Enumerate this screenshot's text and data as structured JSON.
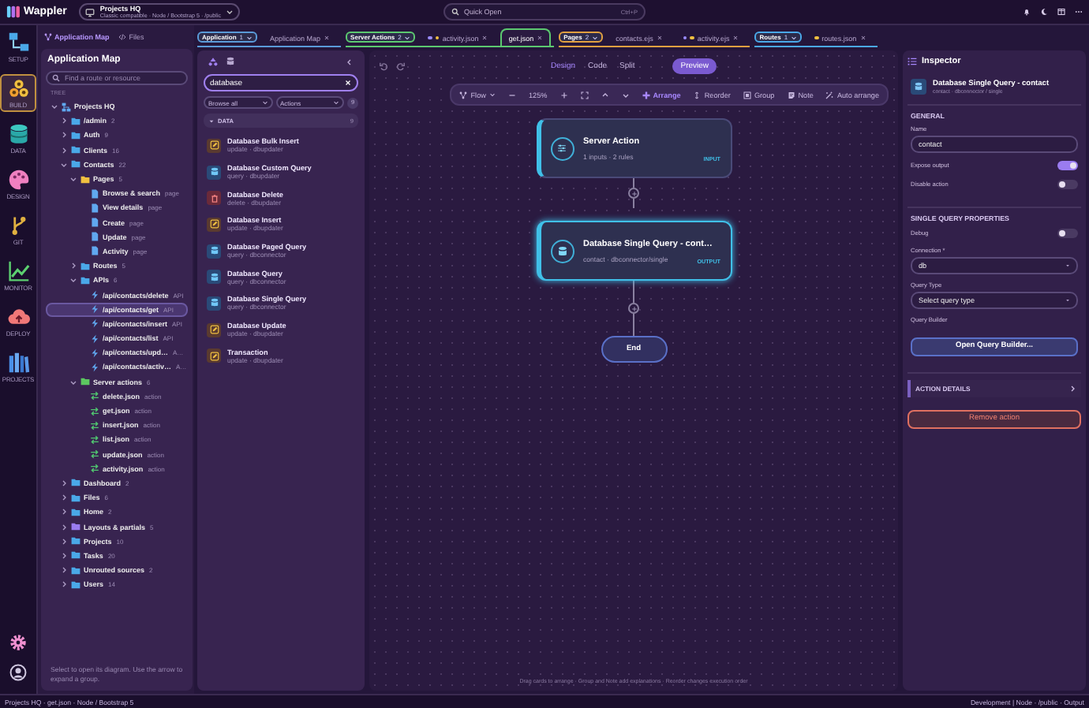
{
  "titlebar": {
    "app_name": "Wappler",
    "project": "Projects HQ",
    "project_detail": "Classic compatible · Node / Bootstrap 5 · /public",
    "search_placeholder": "Quick Open",
    "search_shortcut": "Ctrl+P"
  },
  "rail": [
    {
      "kind": "setup",
      "label": "SETUP",
      "selected": false
    },
    {
      "kind": "build",
      "label": "BUILD",
      "selected": true
    },
    {
      "kind": "data",
      "label": "DATA",
      "selected": false
    },
    {
      "kind": "design",
      "label": "DESIGN",
      "selected": false
    },
    {
      "kind": "git",
      "label": "GIT",
      "selected": false
    },
    {
      "kind": "monitor",
      "label": "MONITOR",
      "selected": false
    },
    {
      "kind": "deploy",
      "label": "DEPLOY",
      "selected": false
    },
    {
      "kind": "projects",
      "label": "PROJECTS",
      "selected": false
    }
  ],
  "left_tabs": [
    {
      "kind": "map",
      "label": "Application Map",
      "selected": true
    },
    {
      "kind": "files",
      "label": "Files",
      "selected": false
    }
  ],
  "app_map": {
    "title": "Application Map",
    "search_placeholder": "Find a route or resource",
    "tree_label": "TREE",
    "hint": "Select to open its diagram. Use the arrow to expand a group.",
    "tree": [
      {
        "kind": "project",
        "label": "Projects HQ",
        "expanded": true,
        "selected": false,
        "children": [
          {
            "kind": "folder",
            "color": "#4aa8e8",
            "label": "/admin",
            "count": "2",
            "expanded": false,
            "selected": false
          },
          {
            "kind": "folder",
            "color": "#4aa8e8",
            "label": "Auth",
            "count": "9",
            "expanded": false,
            "selected": false
          },
          {
            "kind": "folder",
            "color": "#4aa8e8",
            "label": "Clients",
            "count": "16",
            "expanded": false,
            "selected": false
          },
          {
            "kind": "folder",
            "color": "#4aa8e8",
            "label": "Contacts",
            "count": "22",
            "expanded": true,
            "selected": false,
            "children": [
              {
                "kind": "folder",
                "color": "#f0c040",
                "label": "Pages",
                "count": "5",
                "expanded": true,
                "selected": false,
                "children": [
                  {
                    "kind": "page",
                    "label": "Browse & search",
                    "count": "page",
                    "selected": false
                  },
                  {
                    "kind": "page",
                    "label": "View details",
                    "count": "page",
                    "selected": false
                  },
                  {
                    "kind": "page",
                    "label": "Create",
                    "count": "page",
                    "selected": false
                  },
                  {
                    "kind": "page",
                    "label": "Update",
                    "count": "page",
                    "selected": false
                  },
                  {
                    "kind": "page",
                    "label": "Activity",
                    "count": "page",
                    "selected": false
                  }
                ]
              },
              {
                "kind": "folder",
                "color": "#4aa8e8",
                "label": "Routes",
                "count": "5",
                "expanded": false,
                "selected": false
              },
              {
                "kind": "folder",
                "color": "#4aa8e8",
                "label": "APIs",
                "count": "6",
                "expanded": true,
                "selected": false,
                "children": [
                  {
                    "kind": "api",
                    "label": "/api/contacts/delete",
                    "count": "API",
                    "selected": false
                  },
                  {
                    "kind": "api",
                    "label": "/api/contacts/get",
                    "count": "API",
                    "selected": true
                  },
                  {
                    "kind": "api",
                    "label": "/api/contacts/insert",
                    "count": "API",
                    "selected": false
                  },
                  {
                    "kind": "api",
                    "label": "/api/contacts/list",
                    "count": "API",
                    "selected": false
                  },
                  {
                    "kind": "api",
                    "label": "/api/contacts/upd…",
                    "count": "A…",
                    "selected": false
                  },
                  {
                    "kind": "api",
                    "label": "/api/contacts/activ…",
                    "count": "A…",
                    "selected": false
                  }
                ]
              },
              {
                "kind": "folder",
                "color": "#5cc860",
                "label": "Server actions",
                "count": "6",
                "expanded": true,
                "selected": false,
                "children": [
                  {
                    "kind": "action",
                    "label": "delete.json",
                    "count": "action",
                    "selected": false
                  },
                  {
                    "kind": "action",
                    "label": "get.json",
                    "count": "action",
                    "selected": false
                  },
                  {
                    "kind": "action",
                    "label": "insert.json",
                    "count": "action",
                    "selected": false
                  },
                  {
                    "kind": "action",
                    "label": "list.json",
                    "count": "action",
                    "selected": false
                  },
                  {
                    "kind": "action",
                    "label": "update.json",
                    "count": "action",
                    "selected": false
                  },
                  {
                    "kind": "action",
                    "label": "activity.json",
                    "count": "action",
                    "selected": false
                  }
                ]
              }
            ]
          },
          {
            "kind": "folder",
            "color": "#4aa8e8",
            "label": "Dashboard",
            "count": "2",
            "expanded": false,
            "selected": false
          },
          {
            "kind": "folder",
            "color": "#4aa8e8",
            "label": "Files",
            "count": "6",
            "expanded": false,
            "selected": false
          },
          {
            "kind": "folder",
            "color": "#4aa8e8",
            "label": "Home",
            "count": "2",
            "expanded": false,
            "selected": false
          },
          {
            "kind": "folder",
            "color": "#9a7cf0",
            "label": "Layouts & partials",
            "count": "5",
            "expanded": false,
            "selected": false
          },
          {
            "kind": "folder",
            "color": "#4aa8e8",
            "label": "Projects",
            "count": "10",
            "expanded": false,
            "selected": false
          },
          {
            "kind": "folder",
            "color": "#4aa8e8",
            "label": "Tasks",
            "count": "20",
            "expanded": false,
            "selected": false
          },
          {
            "kind": "folder",
            "color": "#4aa8e8",
            "label": "Unrouted sources",
            "count": "2",
            "expanded": false,
            "selected": false
          },
          {
            "kind": "folder",
            "color": "#4aa8e8",
            "label": "Users",
            "count": "14",
            "expanded": false,
            "selected": false
          }
        ]
      }
    ]
  },
  "tab_groups": [
    {
      "label": "Application",
      "count": "1",
      "color": "#5a9ad8",
      "tabs": [
        {
          "label": "Application Map",
          "selected": false
        }
      ]
    },
    {
      "label": "Server Actions",
      "count": "2",
      "color": "#5cc870",
      "tabs": [
        {
          "label": "activity.json",
          "selected": false,
          "dots": [
            {
              "color": "#9a8cff"
            },
            {
              "color": "#f0c040"
            }
          ]
        },
        {
          "label": "get.json",
          "selected": true
        }
      ]
    },
    {
      "label": "Pages",
      "count": "2",
      "color": "#e0a040",
      "tabs": [
        {
          "label": "contacts.ejs",
          "selected": false
        },
        {
          "label": "activity.ejs",
          "selected": false,
          "dots": [
            {
              "color": "#9a8cff"
            },
            {
              "color": "#f0c040"
            }
          ]
        }
      ]
    },
    {
      "label": "Routes",
      "count": "1",
      "color": "#4aa8e8",
      "tabs": [
        {
          "label": "routes.json",
          "selected": false,
          "dots": [
            {
              "color": "#f0c040"
            }
          ]
        }
      ]
    }
  ],
  "actions_panel": {
    "views": [
      {
        "kind": "tree",
        "selected": true
      },
      {
        "kind": "db",
        "selected": false
      }
    ],
    "search_value": "database",
    "filters": [
      "Browse all",
      "Actions"
    ],
    "result_count": "9",
    "group": {
      "label": "DATA",
      "count": "9",
      "expanded": true
    },
    "items": [
      {
        "kind": "update",
        "title": "Database Bulk Insert",
        "subtitle": "update · dbupdater"
      },
      {
        "kind": "query",
        "title": "Database Custom Query",
        "subtitle": "query · dbupdater"
      },
      {
        "kind": "delete",
        "title": "Database Delete",
        "subtitle": "delete · dbupdater"
      },
      {
        "kind": "update",
        "title": "Database Insert",
        "subtitle": "update · dbupdater"
      },
      {
        "kind": "query",
        "title": "Database Paged Query",
        "subtitle": "query · dbconnector"
      },
      {
        "kind": "query",
        "title": "Database Query",
        "subtitle": "query · dbconnector"
      },
      {
        "kind": "query",
        "title": "Database Single Query",
        "subtitle": "query · dbconnector"
      },
      {
        "kind": "update",
        "title": "Database Update",
        "subtitle": "update · dbupdater"
      },
      {
        "kind": "update",
        "title": "Transaction",
        "subtitle": "update · dbupdater"
      }
    ]
  },
  "canvas": {
    "view_tabs": [
      {
        "label": "Design",
        "selected": true
      },
      {
        "label": "Code",
        "selected": false
      },
      {
        "label": "Split",
        "selected": false
      }
    ],
    "preview": "Preview",
    "toolbar": [
      {
        "kind": "flow",
        "label": "Flow"
      },
      {
        "kind": "minus"
      },
      {
        "kind": "zoom",
        "label": "125%"
      },
      {
        "kind": "plus"
      },
      {
        "kind": "fit"
      },
      {
        "kind": "up"
      },
      {
        "kind": "down"
      },
      {
        "kind": "arrange",
        "label": "Arrange"
      },
      {
        "kind": "reorder",
        "label": "Reorder"
      },
      {
        "kind": "group",
        "label": "Group"
      },
      {
        "kind": "note",
        "label": "Note"
      },
      {
        "kind": "auto",
        "label": "Auto arrange"
      }
    ],
    "nodes": [
      {
        "kind": "server",
        "title": "Server Action",
        "subtitle": "1 inputs · 2 rules",
        "tag": "INPUT",
        "selected": false
      },
      {
        "kind": "query",
        "title": "Database Single Query - cont…",
        "subtitle": "contact · dbconnector/single",
        "tag": "OUTPUT",
        "selected": true
      }
    ],
    "end_label": "End",
    "hint": "Drag cards to arrange · Group and Note add explanations · Reorder changes execution order"
  },
  "inspector": {
    "title": "Inspector",
    "action_title": "Database Single Query - contact",
    "action_subtitle": "contact · dbconnector / single",
    "sections": [
      {
        "title": "GENERAL",
        "fields": [
          {
            "kind": "text",
            "label": "Name",
            "value": "contact"
          },
          {
            "kind": "toggle",
            "label": "Expose output",
            "on": true
          },
          {
            "kind": "toggle",
            "label": "Disable action",
            "on": false
          }
        ]
      },
      {
        "title": "SINGLE QUERY PROPERTIES",
        "fields": [
          {
            "kind": "toggle",
            "label": "Debug",
            "on": false
          },
          {
            "kind": "select",
            "label": "Connection *",
            "value": "db"
          },
          {
            "kind": "select",
            "label": "Query Type",
            "value": "Select query type"
          },
          {
            "kind": "button",
            "label": "Query Builder",
            "value": "Open Query Builder..."
          }
        ]
      }
    ],
    "details": {
      "title": "ACTION DETAILS",
      "expanded": false
    },
    "remove_button": "Remove action"
  },
  "status_bar": {
    "left": "Projects HQ · get.json · Node / Bootstrap 5",
    "right": "Development | Node · /public · Output"
  }
}
